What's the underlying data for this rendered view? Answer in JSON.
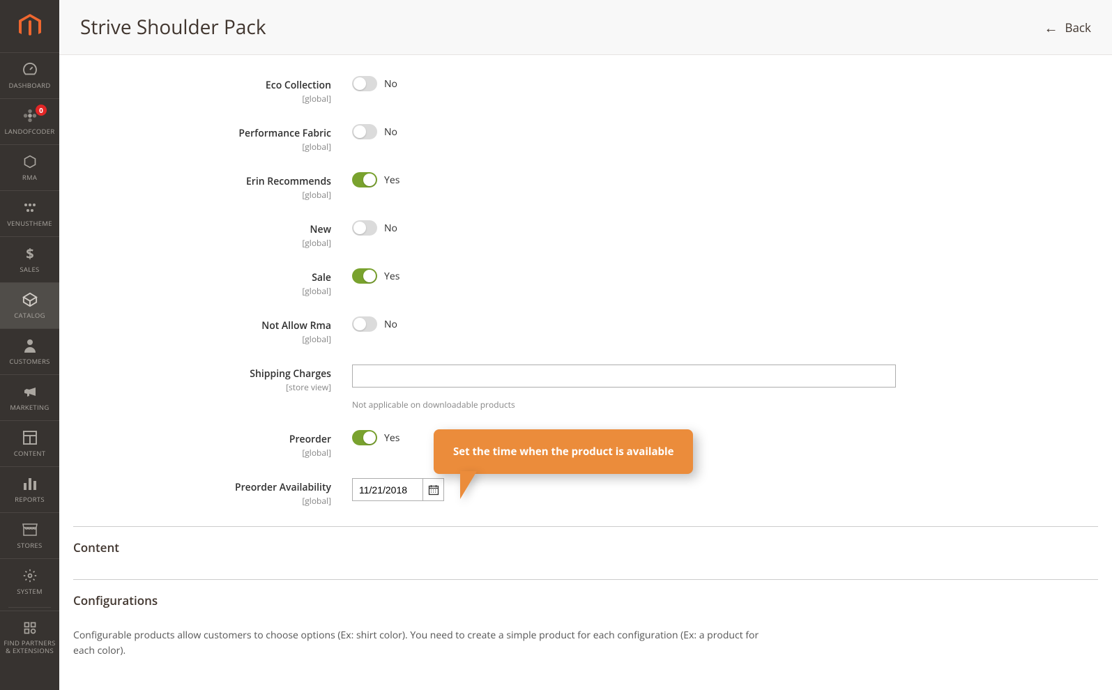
{
  "header": {
    "title": "Strive Shoulder Pack",
    "back_label": "Back"
  },
  "sidebar": {
    "items": [
      {
        "key": "dashboard",
        "label": "DASHBOARD",
        "icon": "gauge"
      },
      {
        "key": "landofcoder",
        "label": "LANDOFCODER",
        "icon": "flower",
        "badge": "0"
      },
      {
        "key": "rma",
        "label": "RMA",
        "icon": "hex"
      },
      {
        "key": "venustheme",
        "label": "VENUSTHEME",
        "icon": "dots"
      },
      {
        "key": "sales",
        "label": "SALES",
        "icon": "dollar"
      },
      {
        "key": "catalog",
        "label": "CATALOG",
        "icon": "cube",
        "active": true
      },
      {
        "key": "customers",
        "label": "CUSTOMERS",
        "icon": "person"
      },
      {
        "key": "marketing",
        "label": "MARKETING",
        "icon": "megaphone"
      },
      {
        "key": "content",
        "label": "CONTENT",
        "icon": "blocks"
      },
      {
        "key": "reports",
        "label": "REPORTS",
        "icon": "bars"
      },
      {
        "key": "stores",
        "label": "STORES",
        "icon": "storefront"
      },
      {
        "key": "system",
        "label": "SYSTEM",
        "icon": "gear"
      },
      {
        "key": "partners",
        "label": "FIND PARTNERS\n& EXTENSIONS",
        "icon": "linkcube"
      }
    ]
  },
  "form": {
    "scope_global": "[global]",
    "scope_storeview": "[store view]",
    "yes": "Yes",
    "no": "No",
    "rows": {
      "eco": {
        "label": "Eco Collection",
        "on": false
      },
      "perf": {
        "label": "Performance Fabric",
        "on": false
      },
      "erin": {
        "label": "Erin Recommends",
        "on": true
      },
      "new": {
        "label": "New",
        "on": false
      },
      "sale": {
        "label": "Sale",
        "on": true
      },
      "rma": {
        "label": "Not Allow Rma",
        "on": false
      },
      "shipping": {
        "label": "Shipping Charges",
        "value": "",
        "helper": "Not applicable on downloadable products"
      },
      "preorder": {
        "label": "Preorder",
        "on": true
      },
      "preorder_avail": {
        "label": "Preorder Availability",
        "value": "11/21/2018"
      }
    }
  },
  "callout": {
    "text": "Set the time when the product is available"
  },
  "sections": {
    "content": {
      "title": "Content"
    },
    "configurations": {
      "title": "Configurations",
      "body": "Configurable products allow customers to choose options (Ex: shirt color). You need to create a simple product for each configuration (Ex: a product for each color)."
    }
  }
}
